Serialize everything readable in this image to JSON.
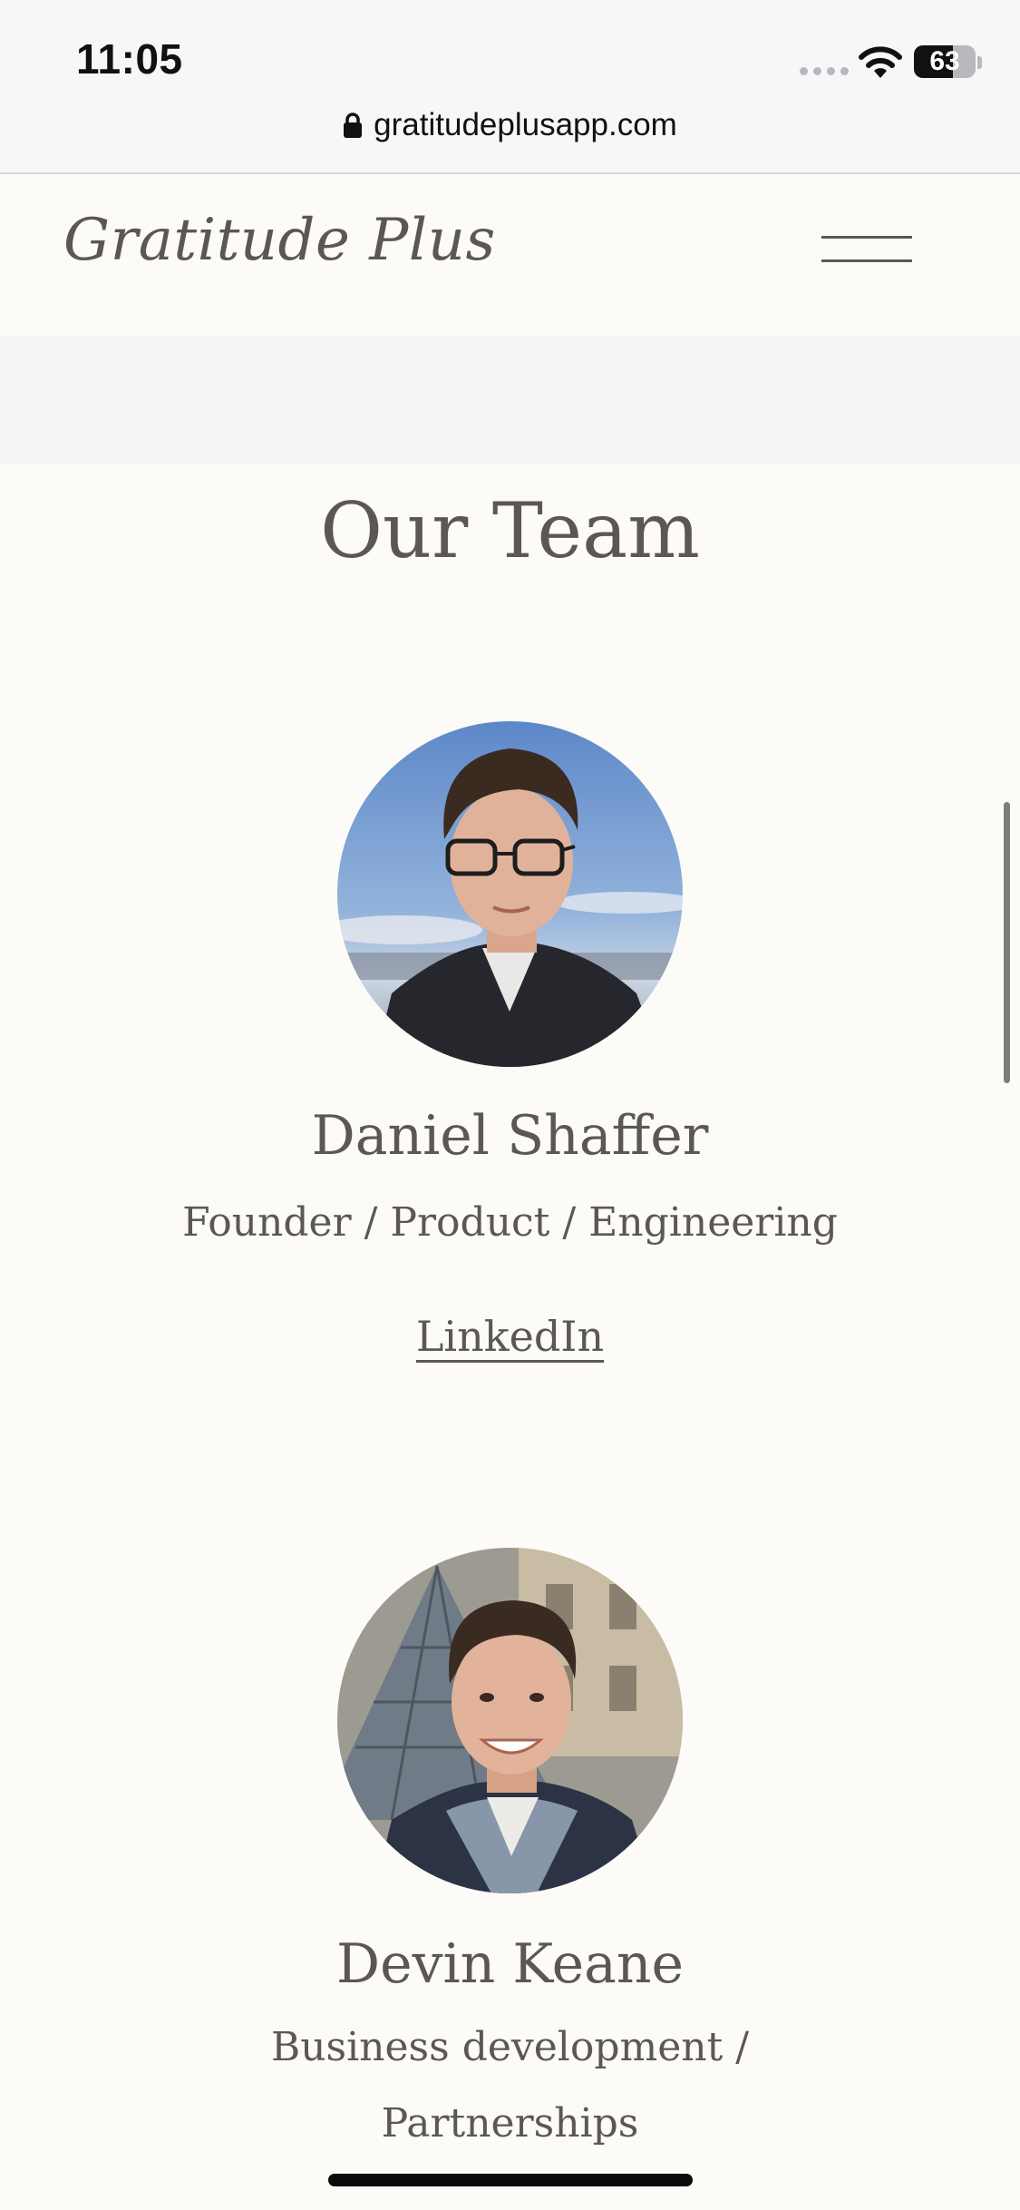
{
  "status_bar": {
    "time": "11:05",
    "battery": {
      "percent": 63,
      "label": "63"
    },
    "url": "gratitudeplusapp.com",
    "icons": [
      "signal-dots-icon",
      "wifi-icon",
      "battery-icon",
      "lock-icon"
    ]
  },
  "header": {
    "brand": "Gratitude Plus",
    "menu_icon": "hamburger-menu-icon"
  },
  "team": {
    "title": "Our Team",
    "members": [
      {
        "name": "Daniel Shaffer",
        "role": "Founder / Product / Engineering",
        "link": "LinkedIn"
      },
      {
        "name": "Devin Keane",
        "role_line1": "Business development /",
        "role_line2": "Partnerships"
      }
    ]
  },
  "colors": {
    "page_background": "#fcfbf7",
    "text": "#5b5852",
    "status_bar_background": "#f7f7f9",
    "band_background": "#f4f4f3"
  }
}
